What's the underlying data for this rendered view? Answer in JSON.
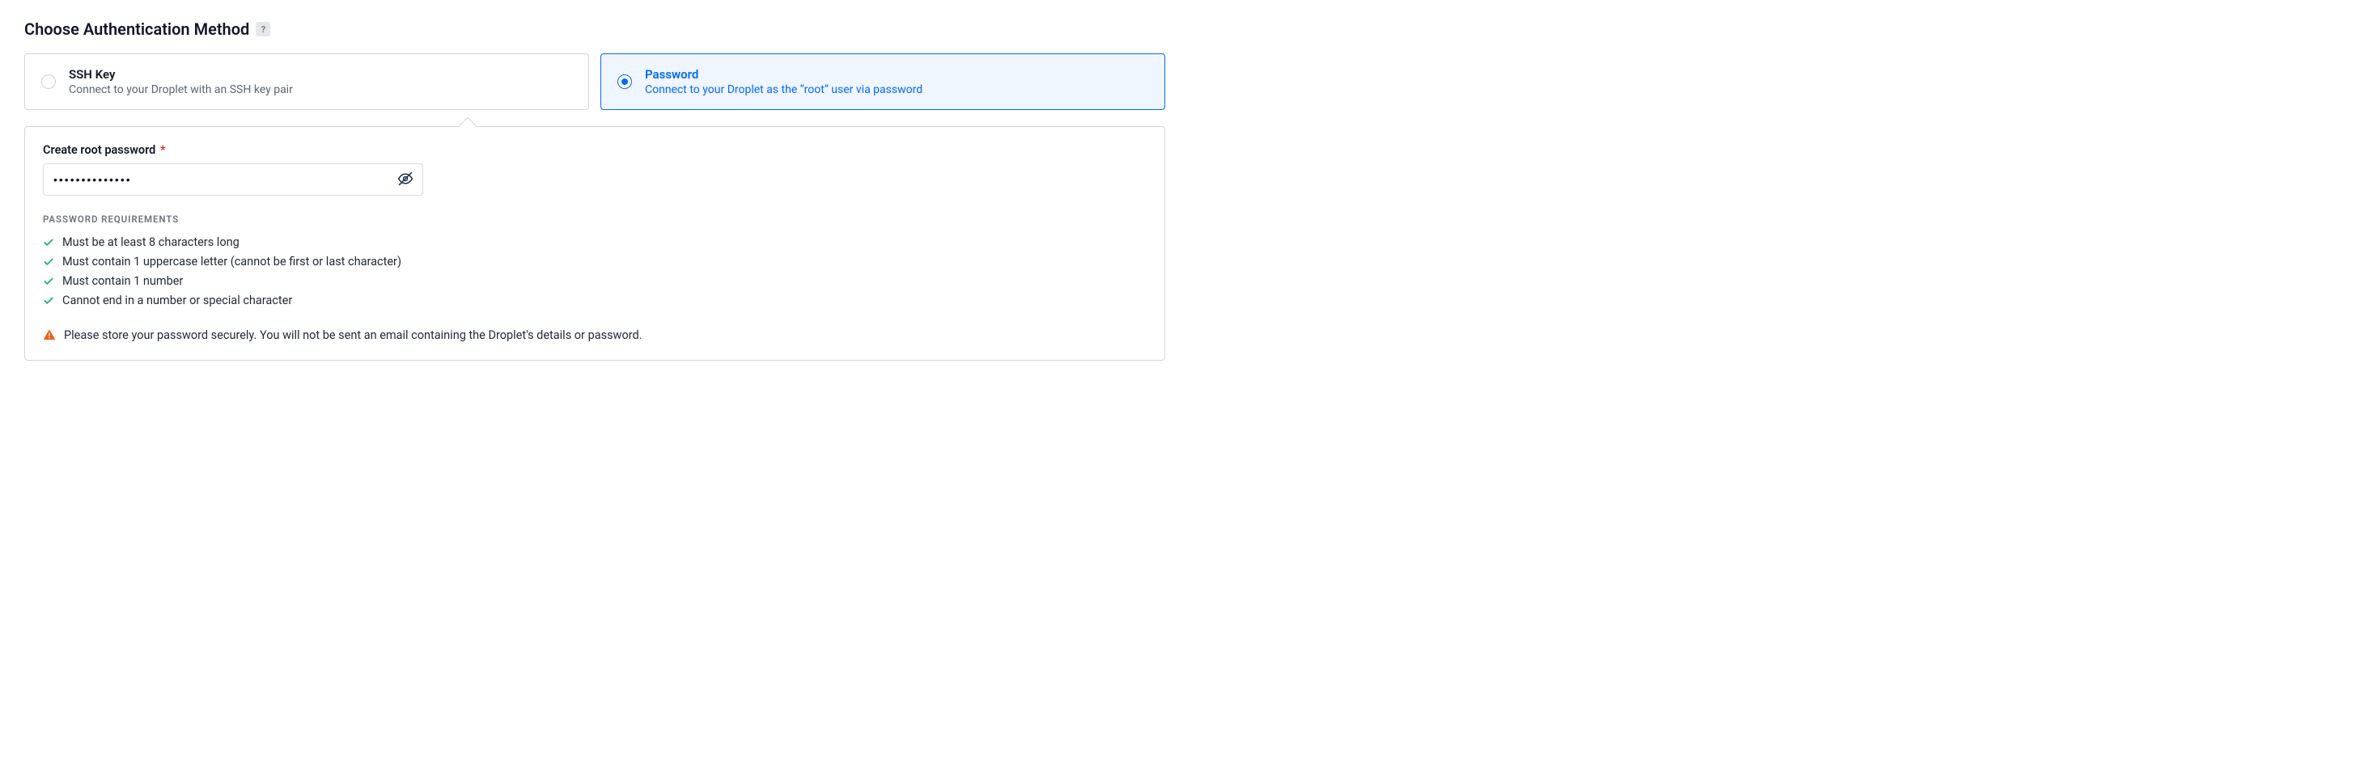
{
  "section": {
    "title": "Choose Authentication Method",
    "help": "?"
  },
  "auth": {
    "options": [
      {
        "title": "SSH Key",
        "desc": "Connect to your Droplet with an SSH key pair",
        "selected": false
      },
      {
        "title": "Password",
        "desc": "Connect to your Droplet as the “root” user via password",
        "selected": true
      }
    ]
  },
  "password_form": {
    "label": "Create root password",
    "required_marker": "*",
    "value": "••••••••••••••",
    "requirements_heading": "PASSWORD REQUIREMENTS",
    "requirements": [
      {
        "met": true,
        "text": "Must be at least 8 characters long"
      },
      {
        "met": true,
        "text": "Must contain 1 uppercase letter (cannot be first or last character)"
      },
      {
        "met": true,
        "text": "Must contain 1 number"
      },
      {
        "met": true,
        "text": "Cannot end in a number or special character"
      }
    ],
    "warning": "Please store your password securely. You will not be sent an email containing the Droplet's details or password."
  }
}
